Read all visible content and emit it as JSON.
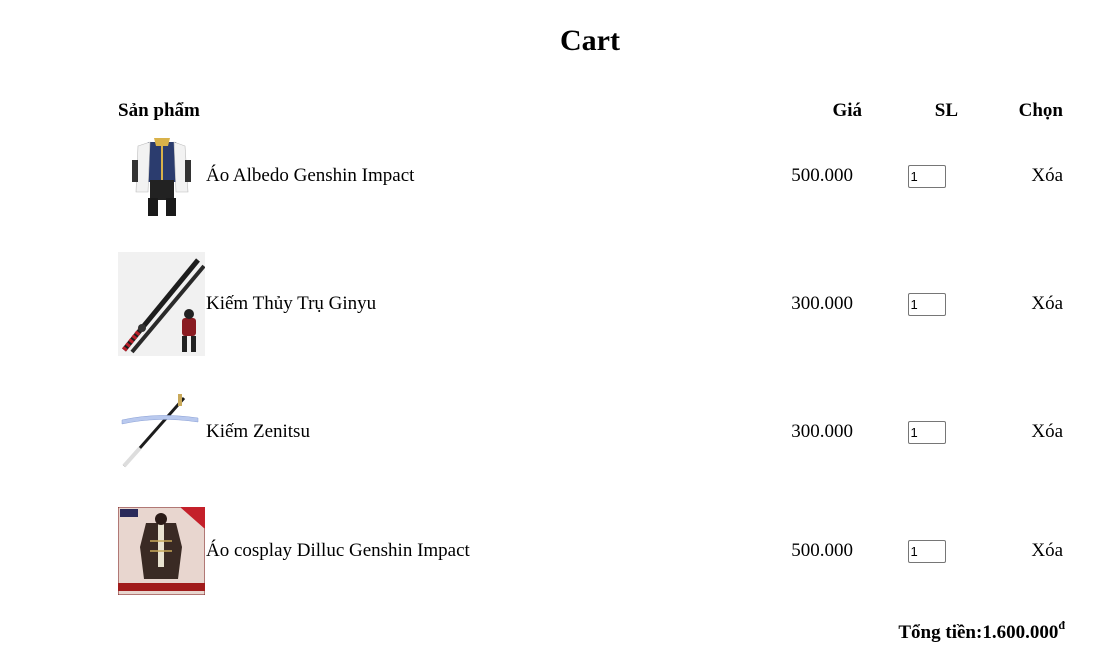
{
  "page": {
    "title": "Cart"
  },
  "table": {
    "headers": {
      "product": "Sản phẩm",
      "price": "Giá",
      "qty": "SL",
      "action": "Chọn"
    },
    "rows": [
      {
        "name": "Áo Albedo Genshin Impact",
        "price": "500.000",
        "qty": "1",
        "action": "Xóa",
        "image_icon": "albedo-costume-image"
      },
      {
        "name": "Kiếm Thủy Trụ Ginyu",
        "price": "300.000",
        "qty": "1",
        "action": "Xóa",
        "image_icon": "giyu-sword-image"
      },
      {
        "name": "Kiếm Zenitsu",
        "price": "300.000",
        "qty": "1",
        "action": "Xóa",
        "image_icon": "zenitsu-sword-image"
      },
      {
        "name": "Áo cosplay Dilluc Genshin Impact",
        "price": "500.000",
        "qty": "1",
        "action": "Xóa",
        "image_icon": "diluc-costume-image"
      }
    ]
  },
  "total": {
    "label": "Tổng tiền:",
    "value": "1.600.000",
    "currency": "đ"
  }
}
